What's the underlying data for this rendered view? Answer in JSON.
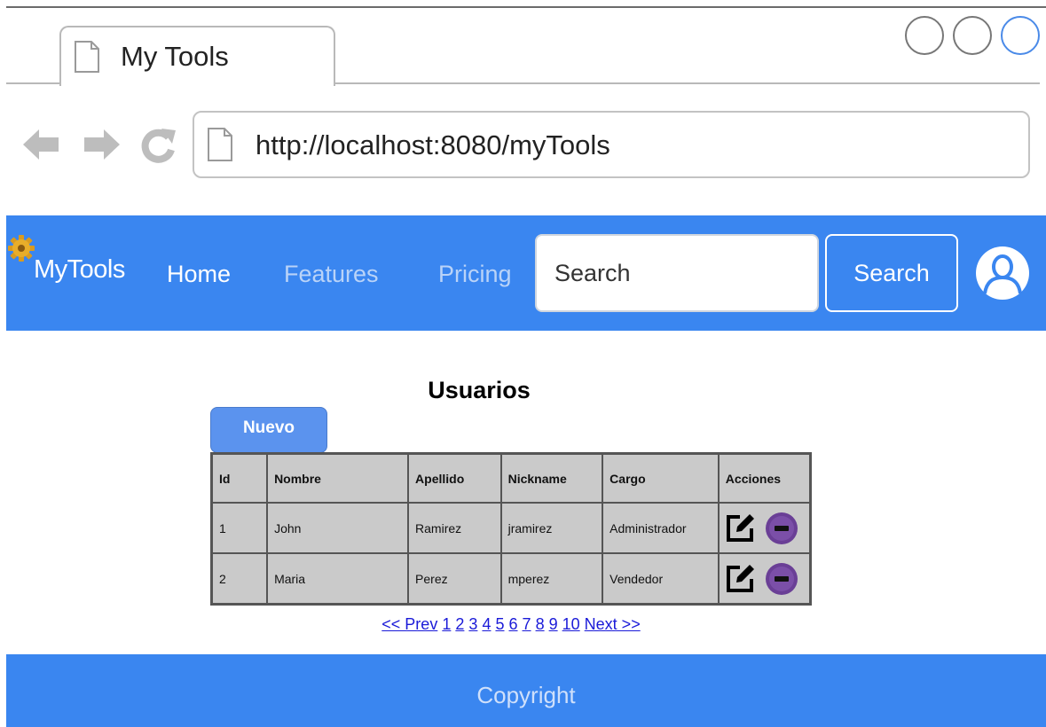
{
  "browser": {
    "tab_title": "My Tools",
    "url": "http://localhost:8080/myTools"
  },
  "navbar": {
    "brand": "MyTools",
    "links": [
      "Home",
      "Features",
      "Pricing"
    ],
    "search_placeholder": "Search",
    "search_button": "Search"
  },
  "main": {
    "title": "Usuarios",
    "new_button": "Nuevo",
    "table": {
      "headers": [
        "Id",
        "Nombre",
        "Apellido",
        "Nickname",
        "Cargo",
        "Acciones"
      ],
      "rows": [
        [
          "1",
          "John",
          "Ramirez",
          "jramirez",
          "Administrador"
        ],
        [
          "2",
          "Maria",
          "Perez",
          "mperez",
          "Vendedor"
        ]
      ]
    },
    "pagination": {
      "prev": "<< Prev",
      "pages": [
        "1",
        "2",
        "3",
        "4",
        "5",
        "6",
        "7",
        "8",
        "9",
        "10"
      ],
      "next": "Next >>"
    }
  },
  "footer": {
    "text": "Copyright"
  },
  "colors": {
    "accent": "#3a86f0",
    "table_bg": "#cacaca",
    "delete_icon": "#6a3f96"
  }
}
